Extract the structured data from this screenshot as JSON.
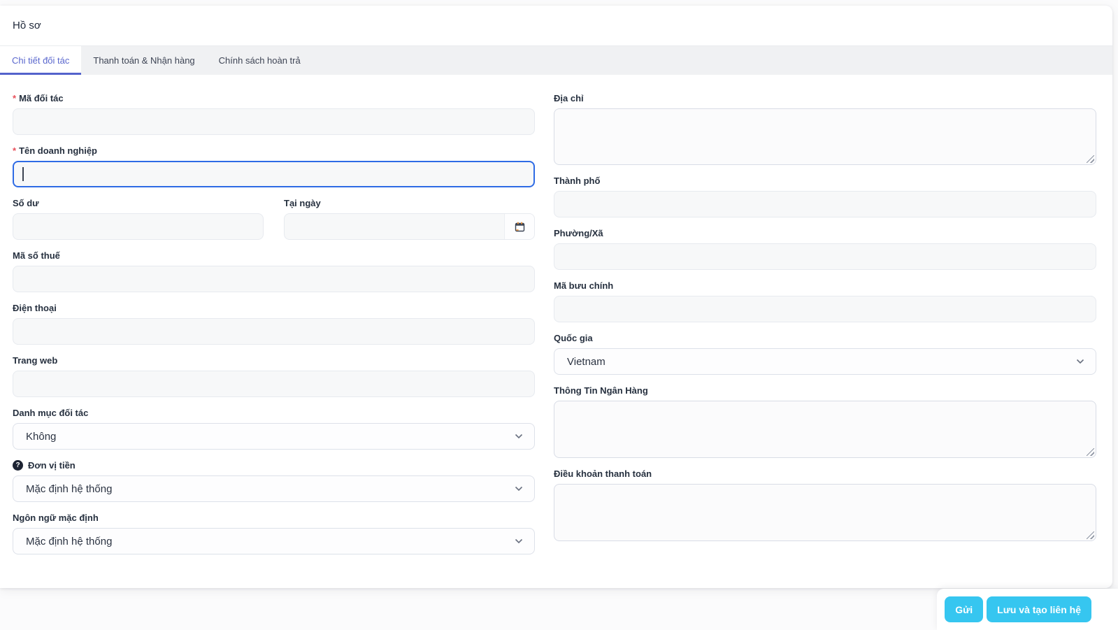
{
  "header": {
    "title": "Hồ sơ"
  },
  "tabs": [
    {
      "label": "Chi tiết đối tác",
      "active": true
    },
    {
      "label": "Thanh toán & Nhận hàng",
      "active": false
    },
    {
      "label": "Chính sách hoàn trả",
      "active": false
    }
  ],
  "ui": {
    "required_marker": "*",
    "help_glyph": "?"
  },
  "form": {
    "left": [
      {
        "label": "Mã đối tác",
        "required": true,
        "type": "text",
        "value": ""
      },
      {
        "label": "Tên doanh nghiệp",
        "required": true,
        "type": "text",
        "value": "",
        "state": "focused"
      },
      {
        "label": "Số dư",
        "type": "text",
        "value": ""
      },
      {
        "label": "Tại ngày",
        "type": "date",
        "value": ""
      },
      {
        "label": "Mã số thuế",
        "type": "text",
        "value": ""
      },
      {
        "label": "Điện thoại",
        "type": "text",
        "value": ""
      },
      {
        "label": "Trang web",
        "type": "text",
        "value": ""
      },
      {
        "label": "Danh mục đối tác",
        "type": "select",
        "value": "Không"
      },
      {
        "label": "Đơn vị tiền",
        "type": "select",
        "value": "Mặc định hệ thống",
        "has_help": true
      },
      {
        "label": "Ngôn ngữ mặc định",
        "type": "select",
        "value": "Mặc định hệ thống"
      }
    ],
    "right": [
      {
        "label": "Địa chỉ",
        "type": "textarea",
        "value": ""
      },
      {
        "label": "Thành phố",
        "type": "text",
        "value": ""
      },
      {
        "label": "Phường/Xã",
        "type": "text",
        "value": ""
      },
      {
        "label": "Mã bưu chính",
        "type": "text",
        "value": ""
      },
      {
        "label": "Quốc gia",
        "type": "select",
        "value": "Vietnam"
      },
      {
        "label": "Thông Tin Ngân Hàng",
        "type": "textarea",
        "value": ""
      },
      {
        "label": "Điều khoản thanh toán",
        "type": "textarea",
        "value": ""
      }
    ]
  },
  "footer": {
    "buttons": [
      {
        "label": "Gửi"
      },
      {
        "label": "Lưu và tạo liên hệ"
      }
    ]
  },
  "colors": {
    "accent_tab_blue": "#5463cc",
    "focus_border_blue": "#2e6be5",
    "button_cyan": "#36c6f0",
    "required_red": "#e8505b",
    "label_dark": "#26303f"
  }
}
